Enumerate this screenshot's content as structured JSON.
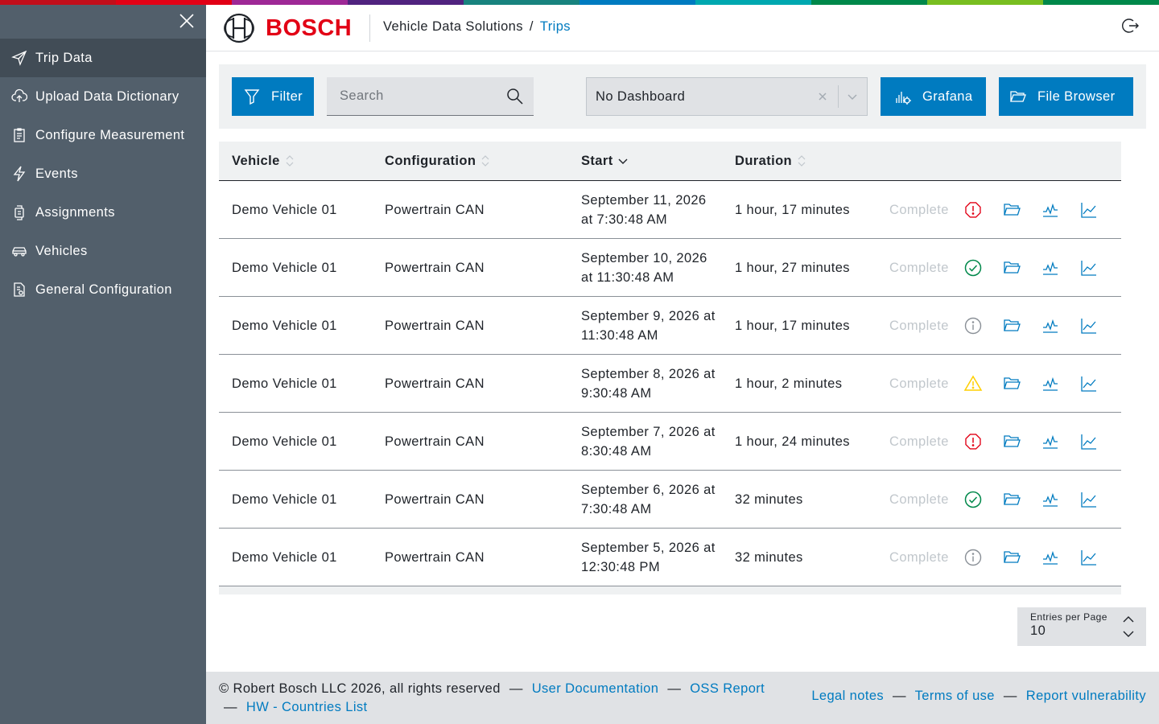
{
  "brand": {
    "name": "BOSCH",
    "red": "#e20015",
    "accent": "#007bc0"
  },
  "supergraphic_colors": [
    "#c20e1a",
    "#e20015",
    "#9e2896",
    "#50237f",
    "#18837e",
    "#007bc0",
    "#00a8b0",
    "#00884a",
    "#78be20",
    "#00884a"
  ],
  "breadcrumb": {
    "app": "Vehicle Data Solutions",
    "separator": "/",
    "current": "Trips"
  },
  "sidebar": {
    "close_icon": "close-icon",
    "items": [
      {
        "label": "Trip Data",
        "icon": "paper-plane-icon",
        "active": true
      },
      {
        "label": "Upload Data Dictionary",
        "icon": "cloud-upload-icon",
        "active": false
      },
      {
        "label": "Configure Measurement",
        "icon": "clipboard-icon",
        "active": false
      },
      {
        "label": "Events",
        "icon": "lightning-icon",
        "active": false
      },
      {
        "label": "Assignments",
        "icon": "device-icon",
        "active": false
      },
      {
        "label": "Vehicles",
        "icon": "car-icon",
        "active": false
      },
      {
        "label": "General Configuration",
        "icon": "document-settings-icon",
        "active": false
      }
    ]
  },
  "toolbar": {
    "filter_label": "Filter",
    "search_placeholder": "Search",
    "dashboard_value": "No Dashboard",
    "grafana_label": "Grafana",
    "file_browser_label": "File Browser"
  },
  "table": {
    "columns": [
      {
        "label": "Vehicle",
        "sort": "none"
      },
      {
        "label": "Configuration",
        "sort": "none"
      },
      {
        "label": "Start",
        "sort": "desc"
      },
      {
        "label": "Duration",
        "sort": "none"
      }
    ],
    "rows": [
      {
        "vehicle": "Demo Vehicle 01",
        "configuration": "Powertrain CAN",
        "start_line1": "September 11, 2026",
        "start_line2": "at 7:30:48 AM",
        "duration": "1 hour, 17 minutes",
        "status": "Complete",
        "state_icon": "error-icon"
      },
      {
        "vehicle": "Demo Vehicle 01",
        "configuration": "Powertrain CAN",
        "start_line1": "September 10, 2026",
        "start_line2": "at 11:30:48 AM",
        "duration": "1 hour, 27 minutes",
        "status": "Complete",
        "state_icon": "success-icon"
      },
      {
        "vehicle": "Demo Vehicle 01",
        "configuration": "Powertrain CAN",
        "start_line1": "September 9, 2026 at",
        "start_line2": "11:30:48 AM",
        "duration": "1 hour, 17 minutes",
        "status": "Complete",
        "state_icon": "info-icon"
      },
      {
        "vehicle": "Demo Vehicle 01",
        "configuration": "Powertrain CAN",
        "start_line1": "September 8, 2026 at",
        "start_line2": "9:30:48 AM",
        "duration": "1 hour, 2 minutes",
        "status": "Complete",
        "state_icon": "warning-icon"
      },
      {
        "vehicle": "Demo Vehicle 01",
        "configuration": "Powertrain CAN",
        "start_line1": "September 7, 2026 at",
        "start_line2": "8:30:48 AM",
        "duration": "1 hour, 24 minutes",
        "status": "Complete",
        "state_icon": "error-icon"
      },
      {
        "vehicle": "Demo Vehicle 01",
        "configuration": "Powertrain CAN",
        "start_line1": "September 6, 2026 at",
        "start_line2": "7:30:48 AM",
        "duration": "32 minutes",
        "status": "Complete",
        "state_icon": "success-icon"
      },
      {
        "vehicle": "Demo Vehicle 01",
        "configuration": "Powertrain CAN",
        "start_line1": "September 5, 2026 at",
        "start_line2": "12:30:48 PM",
        "duration": "32 minutes",
        "status": "Complete",
        "state_icon": "info-icon"
      }
    ]
  },
  "pagination": {
    "entries_label": "Entries per Page",
    "entries_value": "10"
  },
  "footer": {
    "copyright": "© Robert Bosch LLC 2026, all rights reserved",
    "dash": "—",
    "user_docs": "User Documentation",
    "oss_report": "OSS Report",
    "hw_countries": "HW - Countries List",
    "legal_notes": "Legal notes",
    "terms": "Terms of use",
    "report_vuln": "Report vulnerability"
  },
  "status_colors": {
    "error": "#e20015",
    "success": "#00884a",
    "info": "#8a9097",
    "warning": "#ffcf00"
  }
}
